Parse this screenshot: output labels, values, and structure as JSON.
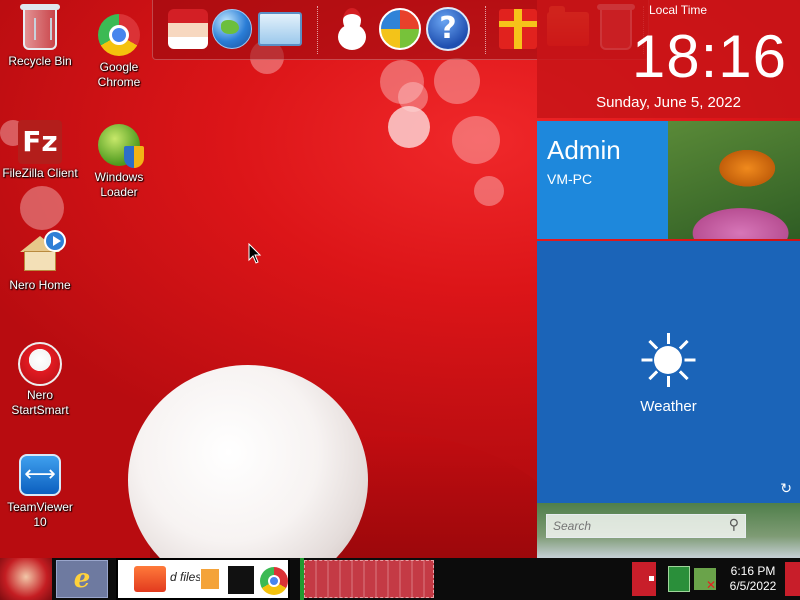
{
  "desktop_icons": [
    {
      "label": "Recycle Bin",
      "icon": "recycle-bin-icon"
    },
    {
      "label": "Google Chrome",
      "icon": "chrome-icon"
    },
    {
      "label": "FileZilla Client",
      "icon": "filezilla-icon"
    },
    {
      "label": "Windows Loader",
      "icon": "windows-loader-icon"
    },
    {
      "label": "Nero Home",
      "icon": "nero-home-icon"
    },
    {
      "label": "Nero StartSmart",
      "icon": "nero-startsmart-icon"
    },
    {
      "label": "TeamViewer 10",
      "icon": "teamviewer-icon"
    }
  ],
  "dock": {
    "items": [
      "santa-screen-icon",
      "globe-icon",
      "control-panel-icon",
      "snowman-icon",
      "windows-circle-icon",
      "help-icon",
      "gift-icon",
      "folder-icon",
      "recycle-bin-icon"
    ]
  },
  "clock_widget": {
    "title": "Local Time",
    "time": "18:16",
    "date": "Sunday, June 5, 2022"
  },
  "user_tile": {
    "name": "Admin",
    "computer": "VM-PC"
  },
  "weather_tile": {
    "label": "Weather"
  },
  "search": {
    "placeholder": "Search"
  },
  "taskbar": {
    "window_label": "d files",
    "clock_time": "6:16 PM",
    "clock_date": "6/5/2022"
  },
  "colors": {
    "wallpaper_red": "#dc1518",
    "user_tile_blue": "#1e88dc",
    "weather_tile_blue": "#1b64b8",
    "taskbar": "#0c0c0c"
  }
}
